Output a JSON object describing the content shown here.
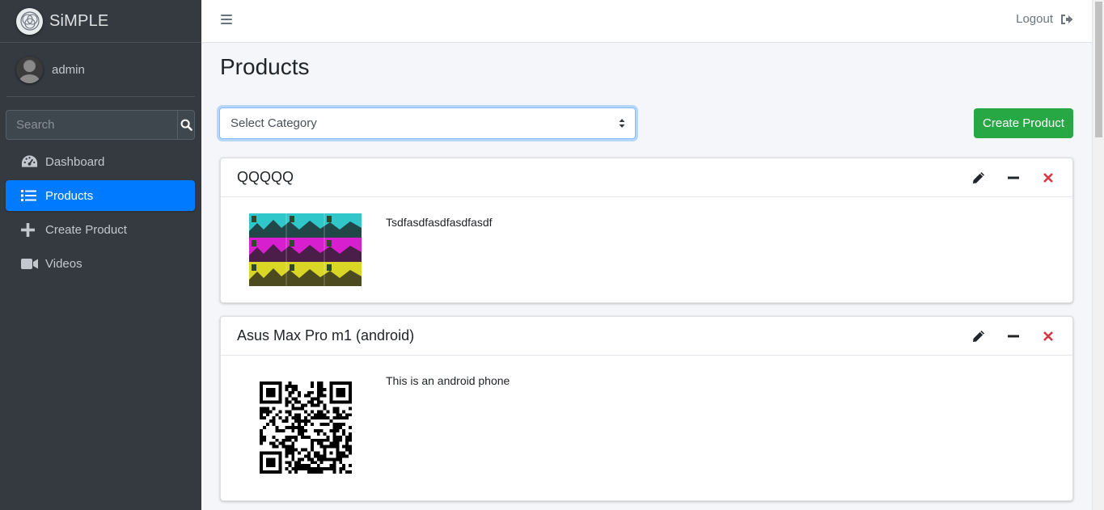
{
  "app": {
    "brand_name": "SiMPLE"
  },
  "user": {
    "name": "admin"
  },
  "search": {
    "placeholder": "Search"
  },
  "sidebar": {
    "items": [
      {
        "label": "Dashboard",
        "icon": "tachometer-icon"
      },
      {
        "label": "Products",
        "icon": "list-icon",
        "active": true
      },
      {
        "label": "Create Product",
        "icon": "plus-icon"
      },
      {
        "label": "Videos",
        "icon": "video-camera-icon"
      }
    ]
  },
  "header": {
    "logout_label": "Logout"
  },
  "page": {
    "title": "Products",
    "category_select": {
      "selected": "Select Category"
    },
    "create_button": "Create Product"
  },
  "products": [
    {
      "name": "QQQQQ",
      "description": "Tsdfasdfasdfasdfasdf",
      "image": "colorful-collage-thumbnail"
    },
    {
      "name": "Asus Max Pro m1 (android)",
      "description": "This is an android phone",
      "image": "qr-code"
    }
  ],
  "colors": {
    "primary": "#007bff",
    "success": "#28a745",
    "danger": "#dc3545",
    "sidebar_bg": "#343a40"
  }
}
